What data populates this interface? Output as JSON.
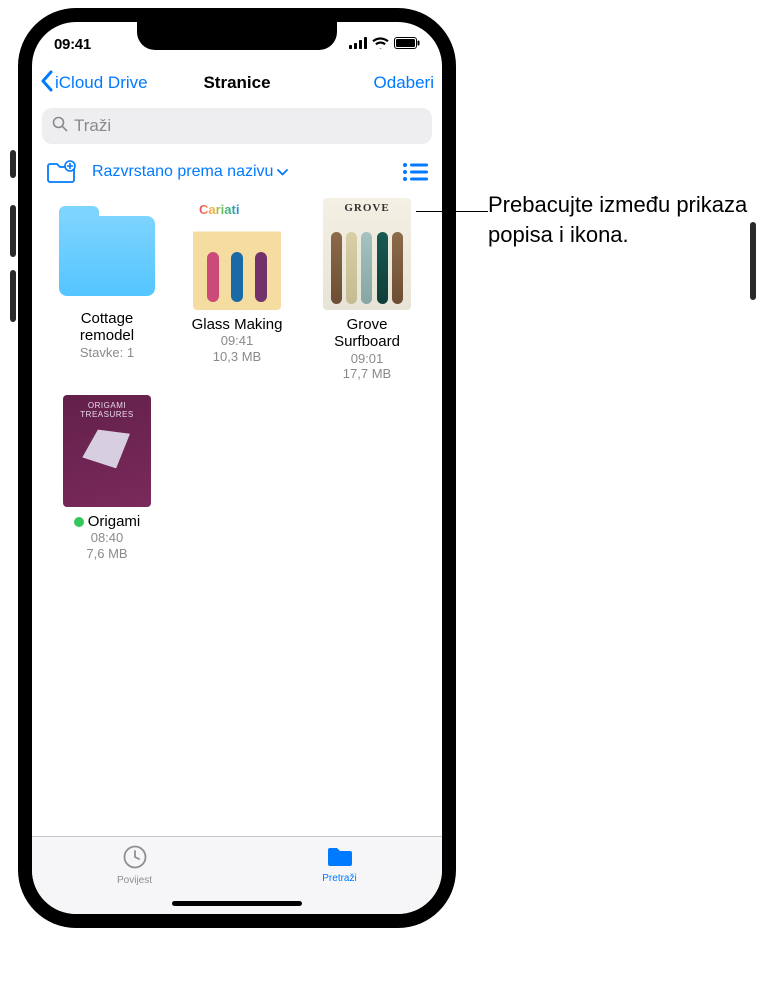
{
  "status": {
    "time": "09:41"
  },
  "nav": {
    "back": "iCloud Drive",
    "title": "Stranice",
    "action": "Odaberi"
  },
  "search": {
    "placeholder": "Traži"
  },
  "toolbar": {
    "sortLabel": "Razvrstano prema nazivu"
  },
  "items": [
    {
      "type": "folder",
      "name": "Cottage remodel",
      "subtitle": "Stavke: 1"
    },
    {
      "type": "doc",
      "name": "Glass Making",
      "time": "09:41",
      "size": "10,3 MB",
      "thumbClass": "thumb-cariati"
    },
    {
      "type": "doc",
      "name": "Grove Surfboard",
      "time": "09:01",
      "size": "17,7 MB",
      "thumbClass": "thumb-grove"
    },
    {
      "type": "doc",
      "name": "Origami",
      "time": "08:40",
      "size": "7,6 MB",
      "thumbClass": "thumb-origami",
      "badge": true
    }
  ],
  "tabs": [
    {
      "label": "Povijest",
      "icon": "clock",
      "active": false
    },
    {
      "label": "Pretraži",
      "icon": "folder",
      "active": true
    }
  ],
  "callout": "Prebacujte između prikaza popisa i ikona."
}
